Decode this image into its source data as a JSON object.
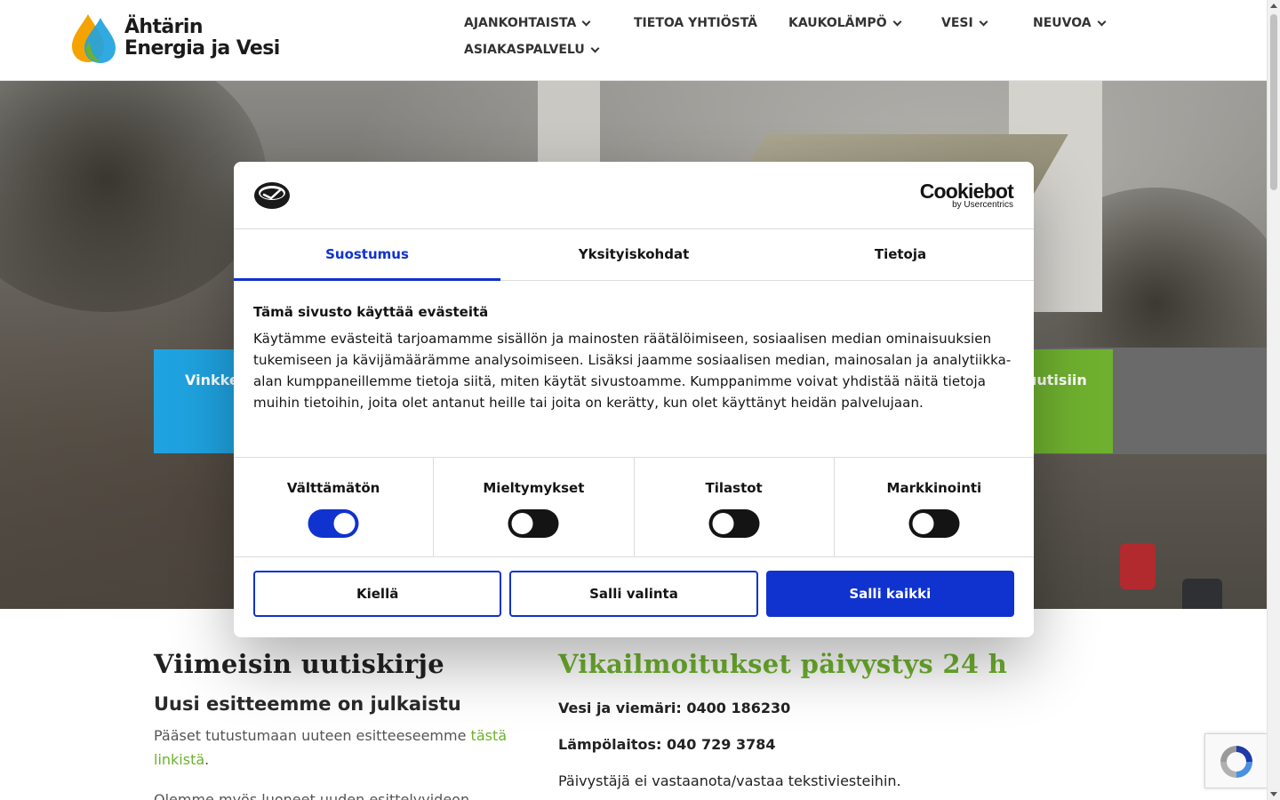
{
  "header": {
    "logo_line1": "Ähtärin",
    "logo_line2": "Energia ja Vesi",
    "nav": [
      {
        "label": "AJANKOHTAISTA",
        "has_dropdown": true
      },
      {
        "label": "TIETOA YHTIÖSTÄ",
        "has_dropdown": false
      },
      {
        "label": "KAUKOLÄMPÖ",
        "has_dropdown": true
      },
      {
        "label": "VESI",
        "has_dropdown": true
      },
      {
        "label": "NEUVOA",
        "has_dropdown": true
      },
      {
        "label": "ASIAKASPALVELU",
        "has_dropdown": true
      }
    ]
  },
  "hero": {
    "tile_left": "Vinkke",
    "tile_right": "uutisiin"
  },
  "news": {
    "heading": "Viimeisin uutiskirje",
    "subheading": "Uusi esitteemme on julkaistu",
    "text_before_link": "Pääset tutustumaan uuteen esitteeseemme",
    "link_text": "tästä linkistä",
    "text_after_link": ".",
    "faded_text": "Olemme myös luoneet uuden esittelyvideon"
  },
  "duty": {
    "heading": "Vikailmoitukset päivystys 24 h",
    "water": "Vesi ja viemäri: 0400 186230",
    "heat": "Lämpölaitos: 040 729 3784",
    "note": "Päivystäjä ei vastaanota/vastaa tekstiviesteihin."
  },
  "cookie_dialog": {
    "brand_main": "Cookiebot",
    "brand_sub": "by Usercentrics",
    "tabs": [
      "Suostumus",
      "Yksityiskohdat",
      "Tietoja"
    ],
    "active_tab": "Suostumus",
    "title": "Tämä sivusto käyttää evästeitä",
    "body": "Käytämme evästeitä tarjoamamme sisällön ja mainosten räätälöimiseen, sosiaalisen median ominaisuuksien tukemiseen ja kävijämäärämme analysoimiseen. Lisäksi jaamme sosiaalisen median, mainosalan ja analytiikka-alan kumppaneillemme tietoja siitä, miten käytät sivustoamme. Kumppanimme voivat yhdistää näitä tietoja muihin tietoihin, joita olet antanut heille tai joita on kerätty, kun olet käyttänyt heidän palvelujaan.",
    "categories": [
      {
        "label": "Välttämätön",
        "enabled": true
      },
      {
        "label": "Mieltymykset",
        "enabled": false
      },
      {
        "label": "Tilastot",
        "enabled": false
      },
      {
        "label": "Markkinointi",
        "enabled": false
      }
    ],
    "buttons": {
      "deny": "Kiellä",
      "allow_selection": "Salli valinta",
      "allow_all": "Salli kaikki"
    }
  },
  "colors": {
    "cookiebot_blue": "#1032cf",
    "brand_green": "#6fb12f",
    "brand_blue": "#1fa3e0"
  }
}
